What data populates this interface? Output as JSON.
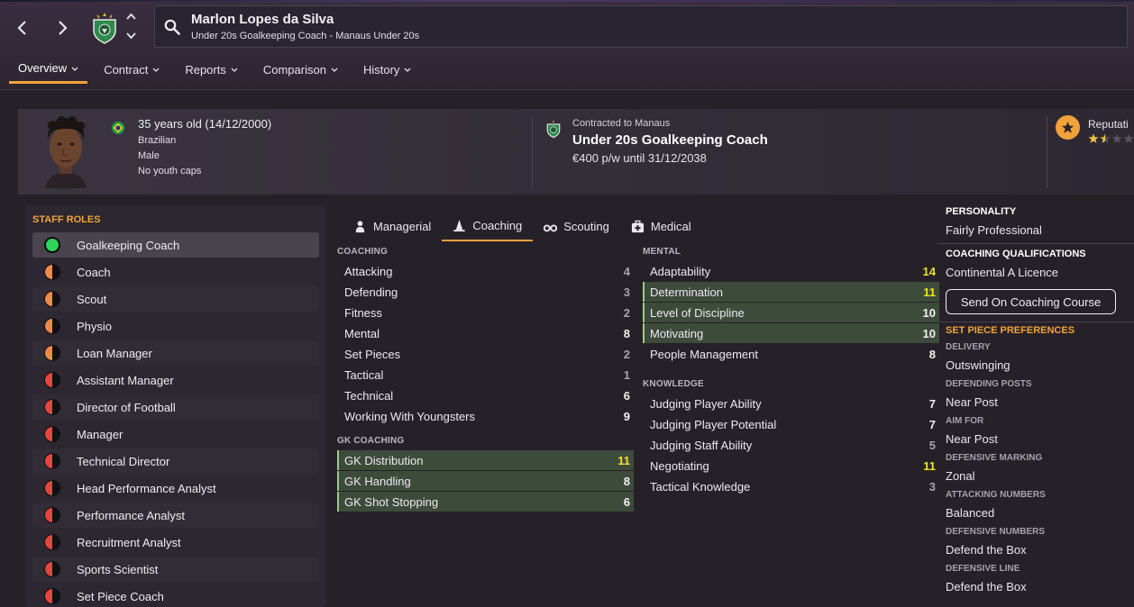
{
  "header": {
    "name": "Marlon Lopes da Silva",
    "subtitle": "Under 20s Goalkeeping Coach - Manaus Under 20s"
  },
  "tabs": [
    "Overview",
    "Contract",
    "Reports",
    "Comparison",
    "History"
  ],
  "profile": {
    "age": "35 years old (14/12/2000)",
    "nationality": "Brazilian",
    "gender": "Male",
    "caps": "No youth caps",
    "contract_label": "Contracted to Manaus",
    "job": "Under 20s Goalkeeping Coach",
    "wage": "€400 p/w until 31/12/2038",
    "reputation_label": "Reputati",
    "reputation_stars": 1.5
  },
  "staff_roles": {
    "title": "STAFF ROLES",
    "items": [
      {
        "label": "Goalkeeping Coach",
        "level": "green"
      },
      {
        "label": "Coach",
        "level": "half-orange"
      },
      {
        "label": "Scout",
        "level": "half-orange"
      },
      {
        "label": "Physio",
        "level": "half-orange"
      },
      {
        "label": "Loan Manager",
        "level": "half-orange"
      },
      {
        "label": "Assistant Manager",
        "level": "half-red"
      },
      {
        "label": "Director of Football",
        "level": "half-red"
      },
      {
        "label": "Manager",
        "level": "half-red"
      },
      {
        "label": "Technical Director",
        "level": "half-red"
      },
      {
        "label": "Head Performance Analyst",
        "level": "half-red"
      },
      {
        "label": "Performance Analyst",
        "level": "half-red"
      },
      {
        "label": "Recruitment Analyst",
        "level": "half-red"
      },
      {
        "label": "Sports Scientist",
        "level": "half-red"
      },
      {
        "label": "Set Piece Coach",
        "level": "half-red"
      }
    ]
  },
  "attr_tabs": [
    "Managerial",
    "Coaching",
    "Scouting",
    "Medical"
  ],
  "coaching": {
    "title": "COACHING",
    "items": [
      {
        "label": "Attacking",
        "value": "4"
      },
      {
        "label": "Defending",
        "value": "3"
      },
      {
        "label": "Fitness",
        "value": "2"
      },
      {
        "label": "Mental",
        "value": "8"
      },
      {
        "label": "Set Pieces",
        "value": "2"
      },
      {
        "label": "Tactical",
        "value": "1"
      },
      {
        "label": "Technical",
        "value": "6"
      },
      {
        "label": "Working With Youngsters",
        "value": "9"
      }
    ]
  },
  "gk_coaching": {
    "title": "GK COACHING",
    "items": [
      {
        "label": "GK Distribution",
        "value": "11"
      },
      {
        "label": "GK Handling",
        "value": "8"
      },
      {
        "label": "GK Shot Stopping",
        "value": "6"
      }
    ]
  },
  "mental": {
    "title": "MENTAL",
    "items": [
      {
        "label": "Adaptability",
        "value": "14"
      },
      {
        "label": "Determination",
        "value": "11"
      },
      {
        "label": "Level of Discipline",
        "value": "10"
      },
      {
        "label": "Motivating",
        "value": "10"
      },
      {
        "label": "People Management",
        "value": "8"
      }
    ]
  },
  "knowledge": {
    "title": "KNOWLEDGE",
    "items": [
      {
        "label": "Judging Player Ability",
        "value": "7"
      },
      {
        "label": "Judging Player Potential",
        "value": "7"
      },
      {
        "label": "Judging Staff Ability",
        "value": "5"
      },
      {
        "label": "Negotiating",
        "value": "11"
      },
      {
        "label": "Tactical Knowledge",
        "value": "3"
      }
    ]
  },
  "right": {
    "personality_title": "PERSONALITY",
    "personality": "Fairly Professional",
    "qual_title": "COACHING QUALIFICATIONS",
    "qual": "Continental A Licence",
    "course_button": "Send On Coaching Course",
    "setpiece_title": "SET PIECE PREFERENCES",
    "prefs": [
      {
        "label": "DELIVERY",
        "value": "Outswinging"
      },
      {
        "label": "DEFENDING POSTS",
        "value": "Near Post"
      },
      {
        "label": "AIM FOR",
        "value": "Near Post"
      },
      {
        "label": "DEFENSIVE MARKING",
        "value": "Zonal"
      },
      {
        "label": "ATTACKING NUMBERS",
        "value": "Balanced"
      },
      {
        "label": "DEFENSIVE NUMBERS",
        "value": "Defend the Box"
      },
      {
        "label": "DEFENSIVE LINE",
        "value": "Defend the Box"
      }
    ]
  },
  "colors": {
    "accent": "#f2a23a",
    "high_value": "#f0e030",
    "highlight_row": "#3d4b3b",
    "role_green": "#2fd45a",
    "role_orange": "#f08a4a",
    "role_red": "#e0483e"
  }
}
